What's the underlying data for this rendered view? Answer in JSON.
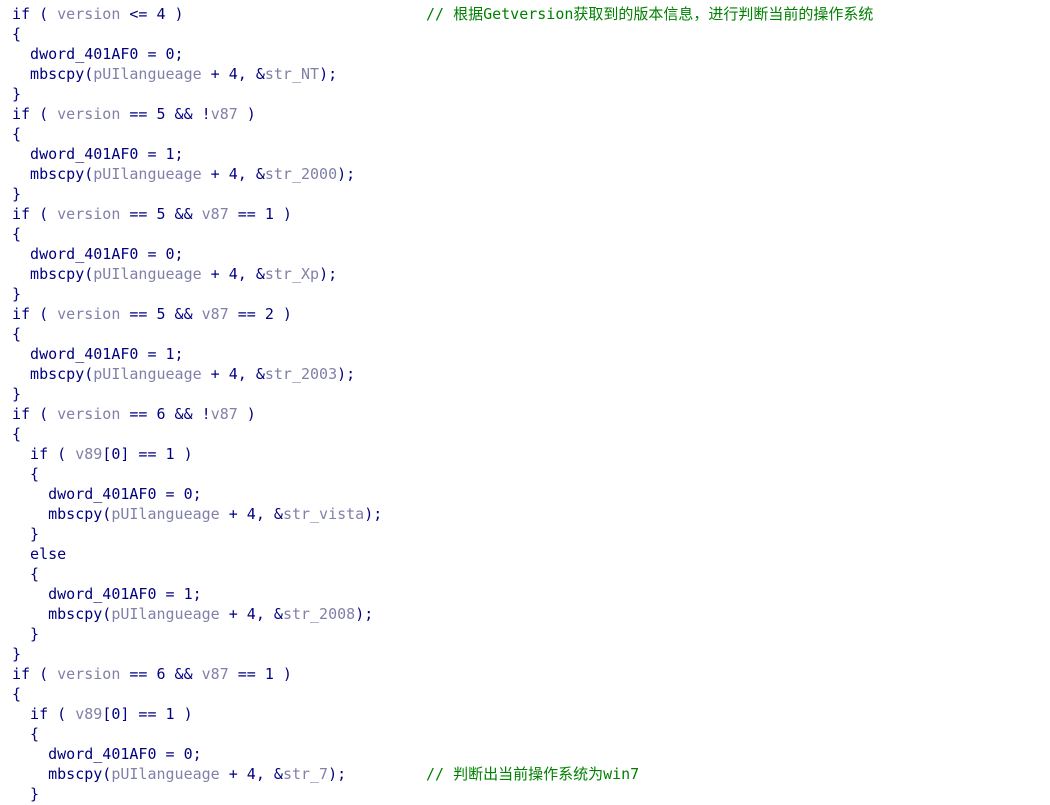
{
  "theme": {
    "keyword_color": "#000080",
    "variable_color": "#8080a8",
    "comment_color": "#008000",
    "background": "#ffffff"
  },
  "code_lines": [
    {
      "tokens": [
        {
          "t": "kw",
          "v": "if ( "
        },
        {
          "t": "var",
          "v": "version"
        },
        {
          "t": "plain",
          "v": " <= 4 )"
        }
      ],
      "comment": "// 根据Getversion获取到的版本信息，进行判断当前的操作系统"
    },
    {
      "tokens": [
        {
          "t": "plain",
          "v": "{"
        }
      ]
    },
    {
      "tokens": [
        {
          "t": "plain",
          "v": "  dword_401AF0 = 0;"
        }
      ]
    },
    {
      "tokens": [
        {
          "t": "plain",
          "v": "  mbscpy("
        },
        {
          "t": "var",
          "v": "pUIlangueage"
        },
        {
          "t": "plain",
          "v": " + 4, &"
        },
        {
          "t": "var",
          "v": "str_NT"
        },
        {
          "t": "plain",
          "v": ");"
        }
      ]
    },
    {
      "tokens": [
        {
          "t": "plain",
          "v": "}"
        }
      ]
    },
    {
      "tokens": [
        {
          "t": "kw",
          "v": "if ( "
        },
        {
          "t": "var",
          "v": "version"
        },
        {
          "t": "plain",
          "v": " == 5 && !"
        },
        {
          "t": "var",
          "v": "v87"
        },
        {
          "t": "plain",
          "v": " )"
        }
      ]
    },
    {
      "tokens": [
        {
          "t": "plain",
          "v": "{"
        }
      ]
    },
    {
      "tokens": [
        {
          "t": "plain",
          "v": "  dword_401AF0 = 1;"
        }
      ]
    },
    {
      "tokens": [
        {
          "t": "plain",
          "v": "  mbscpy("
        },
        {
          "t": "var",
          "v": "pUIlangueage"
        },
        {
          "t": "plain",
          "v": " + 4, &"
        },
        {
          "t": "var",
          "v": "str_2000"
        },
        {
          "t": "plain",
          "v": ");"
        }
      ]
    },
    {
      "tokens": [
        {
          "t": "plain",
          "v": "}"
        }
      ]
    },
    {
      "tokens": [
        {
          "t": "kw",
          "v": "if ( "
        },
        {
          "t": "var",
          "v": "version"
        },
        {
          "t": "plain",
          "v": " == 5 && "
        },
        {
          "t": "var",
          "v": "v87"
        },
        {
          "t": "plain",
          "v": " == 1 )"
        }
      ]
    },
    {
      "tokens": [
        {
          "t": "plain",
          "v": "{"
        }
      ]
    },
    {
      "tokens": [
        {
          "t": "plain",
          "v": "  dword_401AF0 = 0;"
        }
      ]
    },
    {
      "tokens": [
        {
          "t": "plain",
          "v": "  mbscpy("
        },
        {
          "t": "var",
          "v": "pUIlangueage"
        },
        {
          "t": "plain",
          "v": " + 4, &"
        },
        {
          "t": "var",
          "v": "str_Xp"
        },
        {
          "t": "plain",
          "v": ");"
        }
      ]
    },
    {
      "tokens": [
        {
          "t": "plain",
          "v": "}"
        }
      ]
    },
    {
      "tokens": [
        {
          "t": "kw",
          "v": "if ( "
        },
        {
          "t": "var",
          "v": "version"
        },
        {
          "t": "plain",
          "v": " == 5 && "
        },
        {
          "t": "var",
          "v": "v87"
        },
        {
          "t": "plain",
          "v": " == 2 )"
        }
      ]
    },
    {
      "tokens": [
        {
          "t": "plain",
          "v": "{"
        }
      ]
    },
    {
      "tokens": [
        {
          "t": "plain",
          "v": "  dword_401AF0 = 1;"
        }
      ]
    },
    {
      "tokens": [
        {
          "t": "plain",
          "v": "  mbscpy("
        },
        {
          "t": "var",
          "v": "pUIlangueage"
        },
        {
          "t": "plain",
          "v": " + 4, &"
        },
        {
          "t": "var",
          "v": "str_2003"
        },
        {
          "t": "plain",
          "v": ");"
        }
      ]
    },
    {
      "tokens": [
        {
          "t": "plain",
          "v": "}"
        }
      ]
    },
    {
      "tokens": [
        {
          "t": "kw",
          "v": "if ( "
        },
        {
          "t": "var",
          "v": "version"
        },
        {
          "t": "plain",
          "v": " == 6 && !"
        },
        {
          "t": "var",
          "v": "v87"
        },
        {
          "t": "plain",
          "v": " )"
        }
      ]
    },
    {
      "tokens": [
        {
          "t": "plain",
          "v": "{"
        }
      ]
    },
    {
      "tokens": [
        {
          "t": "kw",
          "v": "  if ( "
        },
        {
          "t": "var",
          "v": "v89"
        },
        {
          "t": "plain",
          "v": "[0] == 1 )"
        }
      ]
    },
    {
      "tokens": [
        {
          "t": "plain",
          "v": "  {"
        }
      ]
    },
    {
      "tokens": [
        {
          "t": "plain",
          "v": "    dword_401AF0 = 0;"
        }
      ]
    },
    {
      "tokens": [
        {
          "t": "plain",
          "v": "    mbscpy("
        },
        {
          "t": "var",
          "v": "pUIlangueage"
        },
        {
          "t": "plain",
          "v": " + 4, &"
        },
        {
          "t": "var",
          "v": "str_vista"
        },
        {
          "t": "plain",
          "v": ");"
        }
      ]
    },
    {
      "tokens": [
        {
          "t": "plain",
          "v": "  }"
        }
      ]
    },
    {
      "tokens": [
        {
          "t": "kw",
          "v": "  else"
        }
      ]
    },
    {
      "tokens": [
        {
          "t": "plain",
          "v": "  {"
        }
      ]
    },
    {
      "tokens": [
        {
          "t": "plain",
          "v": "    dword_401AF0 = 1;"
        }
      ]
    },
    {
      "tokens": [
        {
          "t": "plain",
          "v": "    mbscpy("
        },
        {
          "t": "var",
          "v": "pUIlangueage"
        },
        {
          "t": "plain",
          "v": " + 4, &"
        },
        {
          "t": "var",
          "v": "str_2008"
        },
        {
          "t": "plain",
          "v": ");"
        }
      ]
    },
    {
      "tokens": [
        {
          "t": "plain",
          "v": "  }"
        }
      ]
    },
    {
      "tokens": [
        {
          "t": "plain",
          "v": "}"
        }
      ]
    },
    {
      "tokens": [
        {
          "t": "kw",
          "v": "if ( "
        },
        {
          "t": "var",
          "v": "version"
        },
        {
          "t": "plain",
          "v": " == 6 && "
        },
        {
          "t": "var",
          "v": "v87"
        },
        {
          "t": "plain",
          "v": " == 1 )"
        }
      ]
    },
    {
      "tokens": [
        {
          "t": "plain",
          "v": "{"
        }
      ]
    },
    {
      "tokens": [
        {
          "t": "kw",
          "v": "  if ( "
        },
        {
          "t": "var",
          "v": "v89"
        },
        {
          "t": "plain",
          "v": "[0] == 1 )"
        }
      ]
    },
    {
      "tokens": [
        {
          "t": "plain",
          "v": "  {"
        }
      ]
    },
    {
      "tokens": [
        {
          "t": "plain",
          "v": "    dword_401AF0 = 0;"
        }
      ]
    },
    {
      "tokens": [
        {
          "t": "plain",
          "v": "    mbscpy("
        },
        {
          "t": "var",
          "v": "pUIlangueage"
        },
        {
          "t": "plain",
          "v": " + 4, &"
        },
        {
          "t": "var",
          "v": "str_7"
        },
        {
          "t": "plain",
          "v": ");"
        }
      ],
      "comment": "// 判断出当前操作系统为win7"
    },
    {
      "tokens": [
        {
          "t": "plain",
          "v": "  }"
        }
      ]
    }
  ]
}
